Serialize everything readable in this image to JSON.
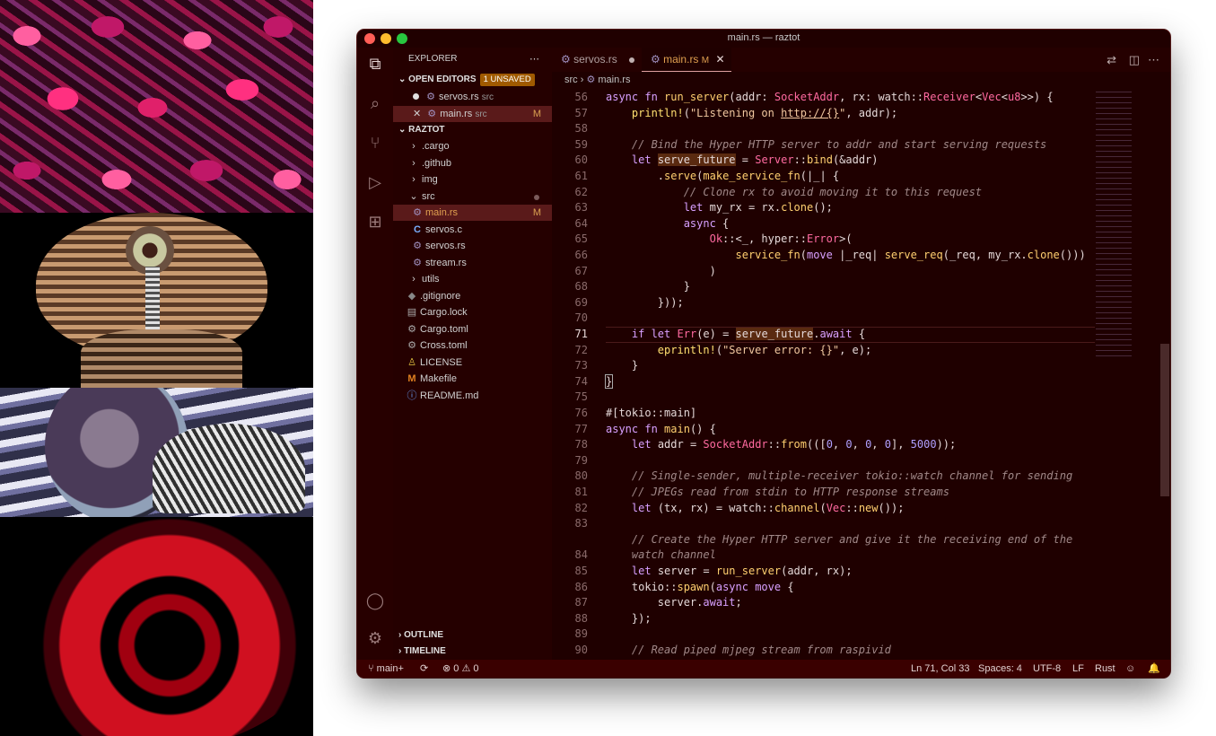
{
  "window": {
    "title": "main.rs — raztot"
  },
  "sidebar": {
    "title": "EXPLORER",
    "open_editors": {
      "label": "OPEN EDITORS",
      "badge": "1 UNSAVED",
      "items": [
        {
          "name": "servos.rs",
          "dir": "src"
        },
        {
          "name": "main.rs",
          "dir": "src",
          "status": "M"
        }
      ]
    },
    "project": "RAZTOT",
    "tree": [
      ".cargo",
      ".github",
      "img",
      "src",
      "main.rs",
      "servos.c",
      "servos.rs",
      "stream.rs",
      "utils",
      ".gitignore",
      "Cargo.lock",
      "Cargo.toml",
      "Cross.toml",
      "LICENSE",
      "Makefile",
      "README.md"
    ],
    "main_status": "M",
    "outline": "OUTLINE",
    "timeline": "TIMELINE"
  },
  "tabs": [
    {
      "label": "servos.rs"
    },
    {
      "label": "main.rs",
      "status": "M"
    }
  ],
  "breadcrumb": {
    "folder": "src",
    "file": "main.rs"
  },
  "editor": {
    "line_numbers": [
      "56",
      "57",
      "58",
      "59",
      "60",
      "61",
      "62",
      "63",
      "64",
      "65",
      "66",
      "67",
      "68",
      "69",
      "70",
      "71",
      "72",
      "73",
      "74",
      "75",
      "76",
      "77",
      "78",
      "79",
      "80",
      "81",
      "82",
      "83",
      "84",
      "85",
      "86",
      "87",
      "88",
      "89",
      "90"
    ]
  },
  "status": {
    "branch": "main+",
    "errors": "0",
    "warnings": "0",
    "position": "Ln 71, Col 33",
    "spaces": "Spaces: 4",
    "encoding": "UTF-8",
    "eol": "LF",
    "language": "Rust"
  },
  "colors": {
    "background": "#1f0000",
    "accent": "#3a0000",
    "modified": "#d9a050"
  }
}
